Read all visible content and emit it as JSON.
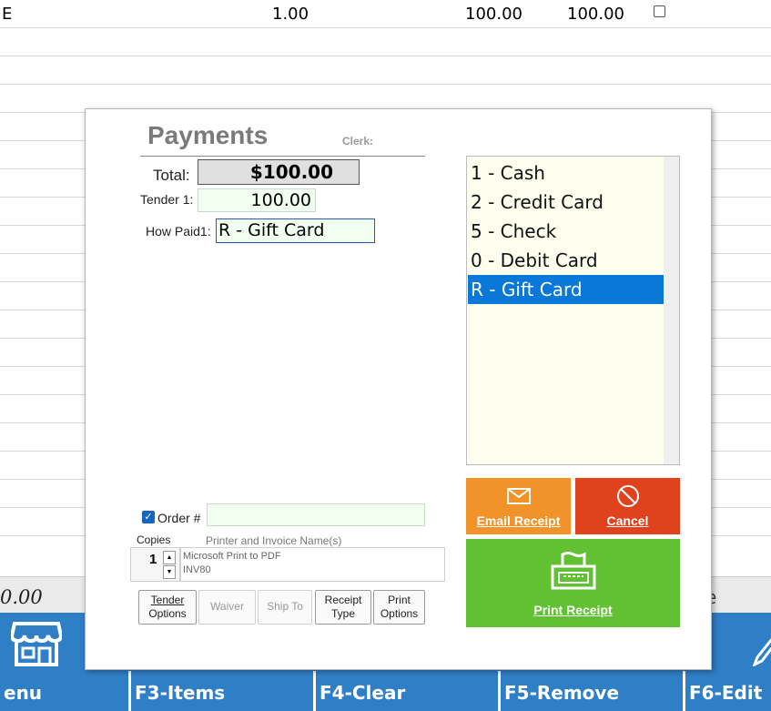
{
  "background": {
    "row": {
      "code": "E",
      "qty": "1.00",
      "price": "100.00",
      "ext": "100.00"
    },
    "total_left": "0.00",
    "total_right": "e"
  },
  "function_keys": [
    {
      "label": "enu"
    },
    {
      "label": "F3-Items"
    },
    {
      "label": "F4-Clear"
    },
    {
      "label": "F5-Remove"
    },
    {
      "label": "F6-Edit"
    }
  ],
  "dialog": {
    "title": "Payments",
    "clerk_label": "Clerk:",
    "total_label": "Total:",
    "total_value": "$100.00",
    "tender_label": "Tender 1:",
    "tender_value": "100.00",
    "howpaid_label": "How Paid1:",
    "howpaid_value": "R - Gift Card",
    "payment_methods": [
      "1 - Cash",
      "2 - Credit Card",
      "5 - Check",
      "0 - Debit Card",
      "R - Gift Card"
    ],
    "selected_method": "R - Gift Card",
    "order_label": "Order #",
    "order_value": "",
    "copies_label": "Copies",
    "copies_value": "1",
    "printer_label": "Printer and Invoice Name(s)",
    "printer_name": "Microsoft Print to PDF",
    "invoice_name": "INV80",
    "buttons": {
      "tender_options": [
        "Tender",
        "Options"
      ],
      "waiver": "Waiver",
      "ship_to": "Ship To",
      "receipt_type": [
        "Receipt",
        "Type"
      ],
      "print_options": [
        "Print",
        "Options"
      ],
      "email_receipt": "Email Receipt",
      "cancel": "Cancel",
      "print_receipt": "Print Receipt"
    }
  },
  "colors": {
    "accent_blue": "#2f7fc7",
    "email": "#f2932a",
    "cancel": "#e0421e",
    "print": "#61c132",
    "selection": "#0a78d7"
  }
}
